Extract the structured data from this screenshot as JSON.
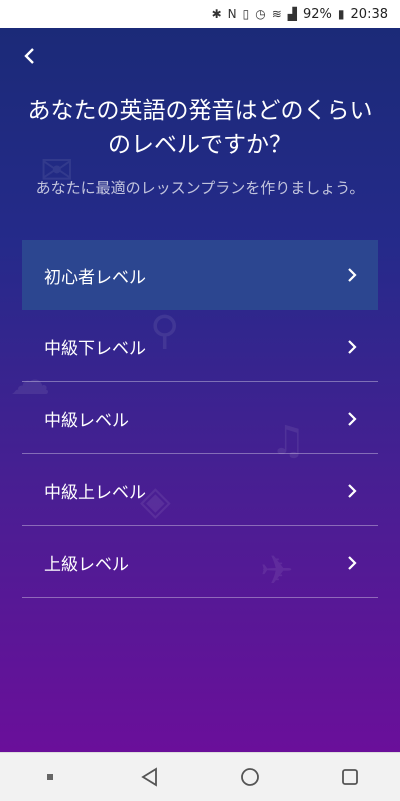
{
  "status": {
    "battery": "92%",
    "time": "20:38",
    "icons": [
      "bluetooth-icon",
      "nfc-icon",
      "vibrate-icon",
      "alarm-icon",
      "wifi-icon",
      "signal-icon",
      "battery-icon"
    ]
  },
  "header": {
    "back_icon": "chevron-left-icon",
    "title": "あなたの英語の発音はどのくらいのレベルですか？",
    "subtitle": "あなたに最適のレッスンプランを作りましょう。"
  },
  "levels": [
    {
      "label": "初心者レベル",
      "selected": true
    },
    {
      "label": "中級下レベル",
      "selected": false
    },
    {
      "label": "中級レベル",
      "selected": false
    },
    {
      "label": "中級上レベル",
      "selected": false
    },
    {
      "label": "上級レベル",
      "selected": false
    }
  ],
  "colors": {
    "gradient_top": "#1b2a78",
    "gradient_bottom": "#6a0f9a",
    "selected_row": "#2c4690"
  },
  "navbar": {
    "icons": [
      "recent-apps-dot-icon",
      "back-triangle-icon",
      "home-circle-icon",
      "overview-square-icon"
    ]
  }
}
